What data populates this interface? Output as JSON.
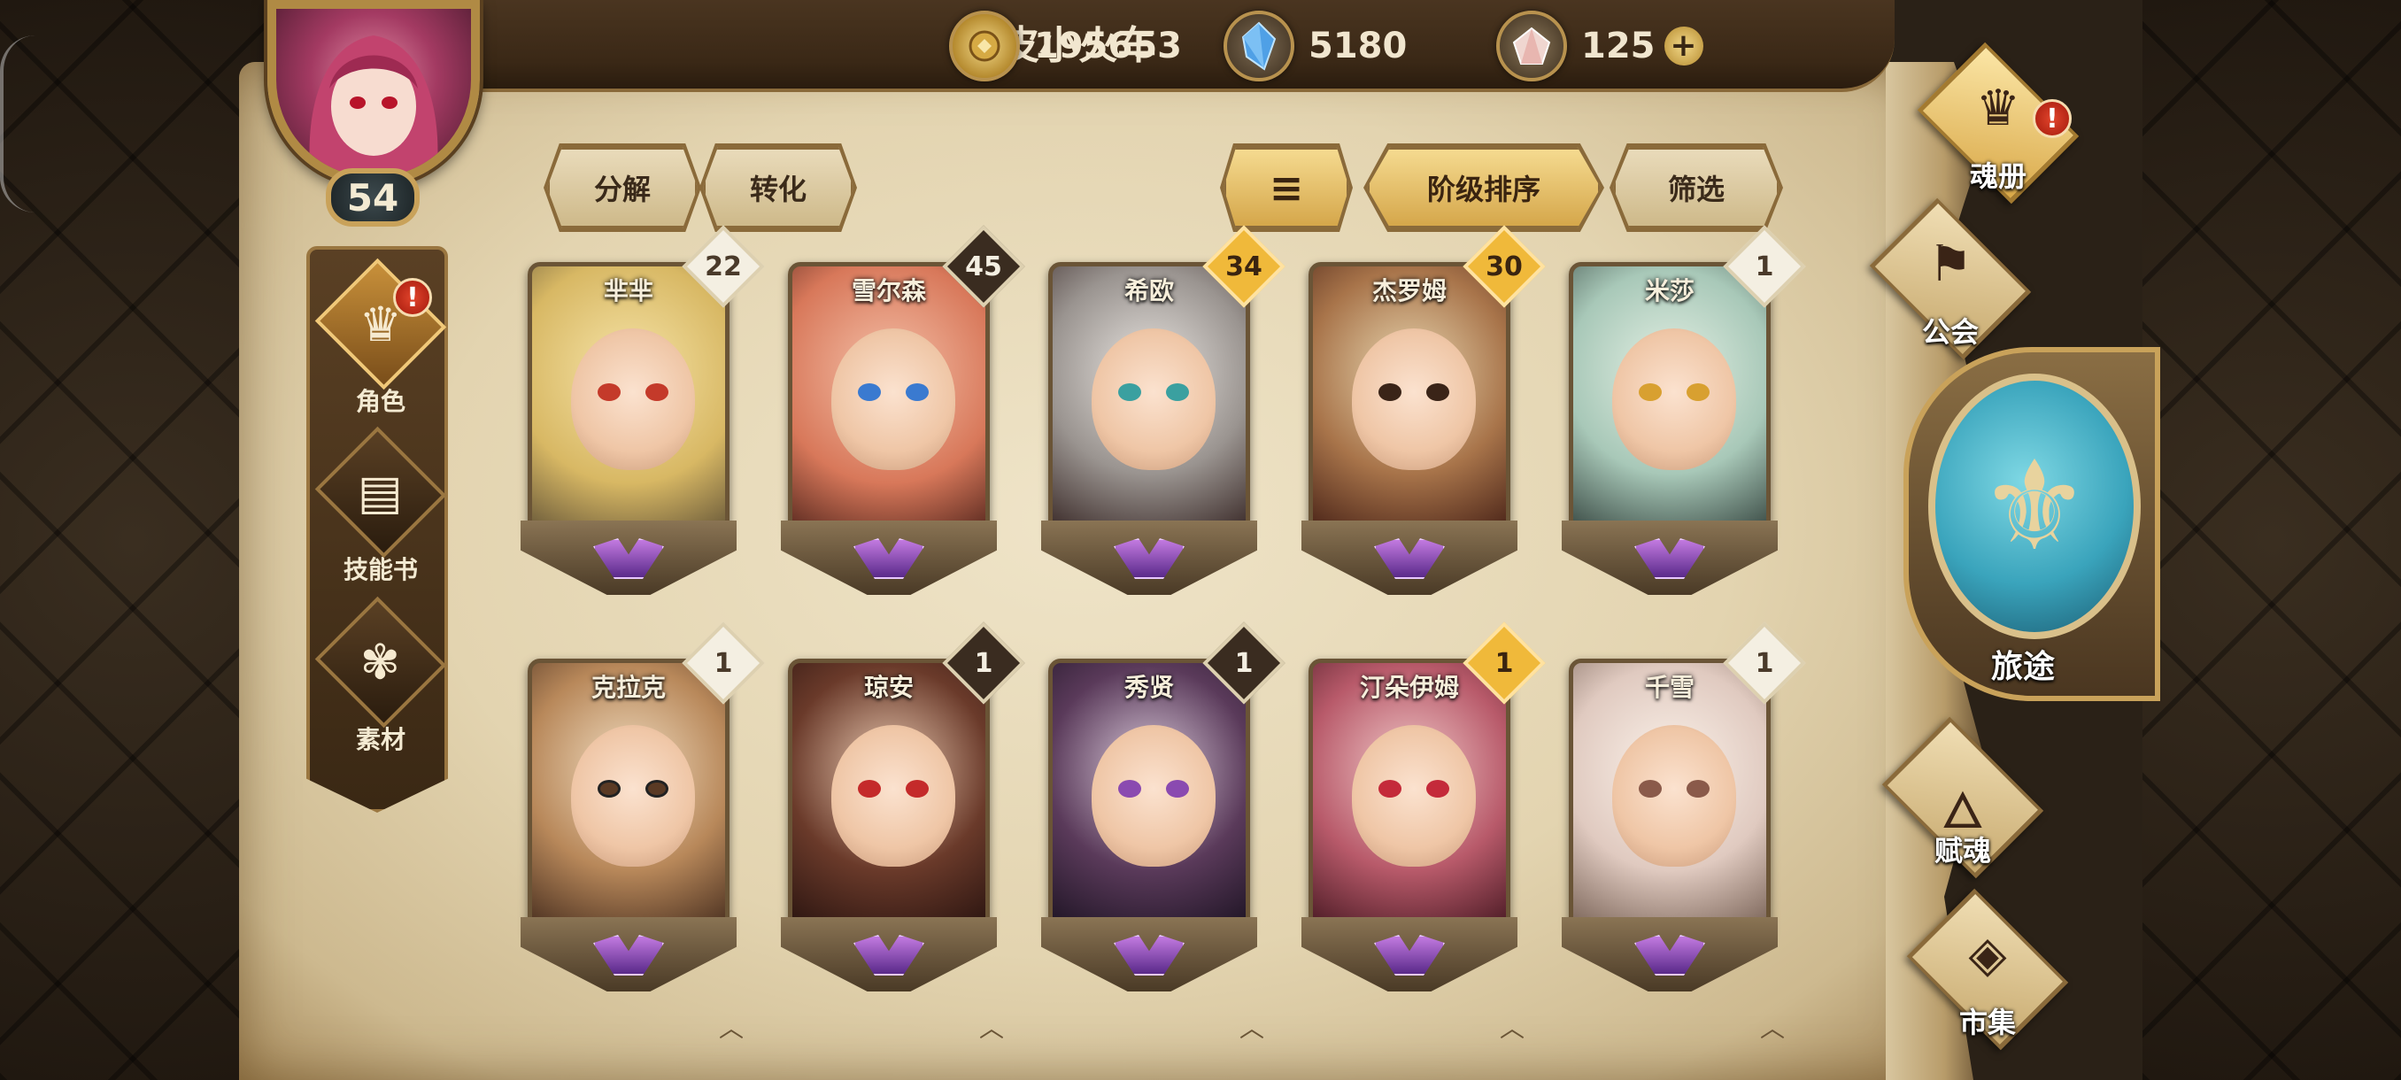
{
  "player": {
    "name": "绿皮小火车",
    "level": "54"
  },
  "currencies": {
    "gold": "195653",
    "crystal": "5180",
    "gem": "125",
    "gem_add": "+"
  },
  "left_nav": {
    "items": [
      {
        "label": "角色",
        "icon": "character-icon",
        "active": true,
        "alert": "!"
      },
      {
        "label": "技能书",
        "icon": "skill-book-icon",
        "active": false
      },
      {
        "label": "素材",
        "icon": "material-icon",
        "active": false
      }
    ]
  },
  "toolbar": {
    "decompose": "分解",
    "convert": "转化",
    "sort_order": "阶级排序",
    "filter": "筛选"
  },
  "heroes": [
    {
      "name": "芈芈",
      "level": "22"
    },
    {
      "name": "雪尔森",
      "level": "45"
    },
    {
      "name": "希欧",
      "level": "34"
    },
    {
      "name": "杰罗姆",
      "level": "30"
    },
    {
      "name": "米莎",
      "level": "1"
    },
    {
      "name": "克拉克",
      "level": "1"
    },
    {
      "name": "琼安",
      "level": "1"
    },
    {
      "name": "秀贤",
      "level": "1"
    },
    {
      "name": "汀朵伊姆",
      "level": "1"
    },
    {
      "name": "千雪",
      "level": "1"
    }
  ],
  "right_menu": {
    "soul_book": "魂册",
    "soul_book_alert": "!",
    "guild": "公会",
    "journey": "旅途",
    "soul_grant": "赋魂",
    "market": "市集"
  },
  "colors": {
    "accent_gold": "#f0b93a",
    "parchment": "#e3d4b0",
    "frame_brown": "#8a6a3a",
    "alert_red": "#d2301c",
    "journey_teal": "#3aa4bc"
  }
}
